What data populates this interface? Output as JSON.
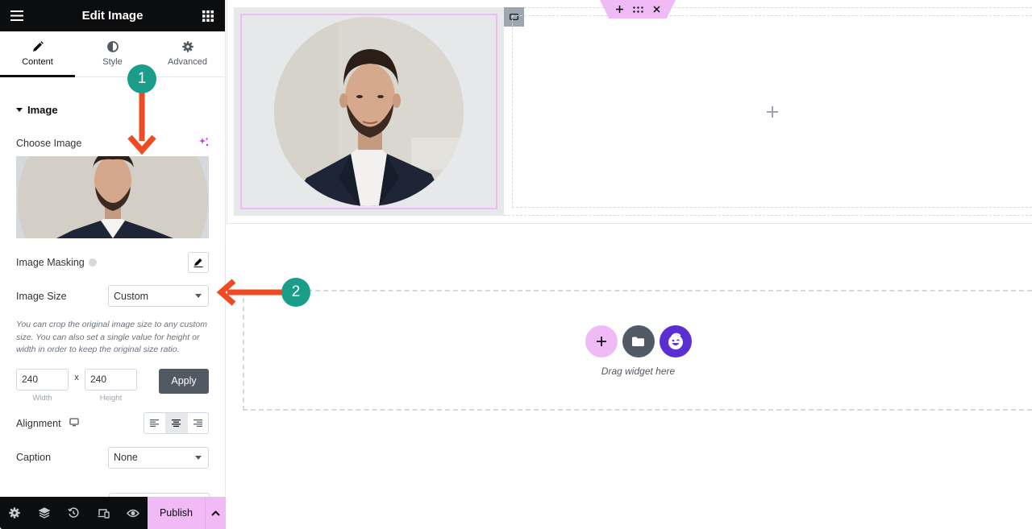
{
  "header": {
    "title": "Edit Image",
    "menu_icon": "hamburger-icon",
    "apps_icon": "grid-icon"
  },
  "tabs": [
    {
      "label": "Content",
      "icon": "pencil-icon",
      "active": true
    },
    {
      "label": "Style",
      "icon": "half-circle-icon",
      "active": false
    },
    {
      "label": "Advanced",
      "icon": "gear-icon",
      "active": false
    }
  ],
  "section": {
    "title": "Image",
    "choose_image_label": "Choose Image",
    "image_masking_label": "Image Masking",
    "image_size_label": "Image Size",
    "image_size_value": "Custom",
    "help_text": "You can crop the original image size to any custom size. You can also set a single value for height or width in order to keep the original size ratio.",
    "width_value": "240",
    "width_label": "Width",
    "height_value": "240",
    "height_label": "Height",
    "times_symbol": "x",
    "apply_label": "Apply",
    "alignment_label": "Alignment",
    "alignment_options": [
      "left",
      "center",
      "right"
    ],
    "alignment_selected": "center",
    "caption_label": "Caption",
    "caption_value": "None"
  },
  "footer": {
    "icons": [
      "settings-icon",
      "layers-icon",
      "history-icon",
      "responsive-icon",
      "preview-icon"
    ],
    "publish_label": "Publish"
  },
  "canvas": {
    "drop_text": "Drag widget here",
    "section_toolbar": [
      "add",
      "drag",
      "close"
    ]
  },
  "annotations": [
    {
      "number": "1",
      "target": "Choose Image"
    },
    {
      "number": "2",
      "target": "Image Size"
    }
  ],
  "colors": {
    "accent_pink": "#f0baf7",
    "dark": "#0c0d0e",
    "badge_teal": "#1a9e8a",
    "arrow_red": "#f04a23",
    "ai_purple": "#5c2ed1"
  }
}
